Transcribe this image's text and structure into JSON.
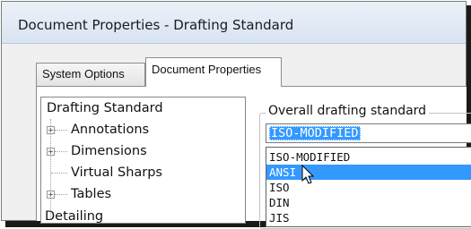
{
  "window": {
    "title": "Document Properties - Drafting Standard"
  },
  "tabs": [
    {
      "label": "System Options",
      "active": false
    },
    {
      "label": "Document Properties",
      "active": true
    }
  ],
  "tree": {
    "root": "Drafting Standard",
    "children": [
      {
        "label": "Annotations",
        "expandable": true
      },
      {
        "label": "Dimensions",
        "expandable": true
      },
      {
        "label": "Virtual Sharps",
        "expandable": false
      },
      {
        "label": "Tables",
        "expandable": true
      }
    ],
    "next_root": "Detailing"
  },
  "standard_group": {
    "legend": "Overall drafting standard",
    "selected_value": "ISO-MODIFIED",
    "options": [
      "ISO-MODIFIED",
      "ANSI",
      "ISO",
      "DIN",
      "JIS"
    ],
    "highlighted_option": "ANSI"
  },
  "colors": {
    "selection": "#3399ff",
    "titlebar": "#dde7f3",
    "window_bg": "#f0f0f0"
  },
  "icons": {
    "expander": "plus-box-icon",
    "cursor": "arrow-cursor-icon"
  }
}
